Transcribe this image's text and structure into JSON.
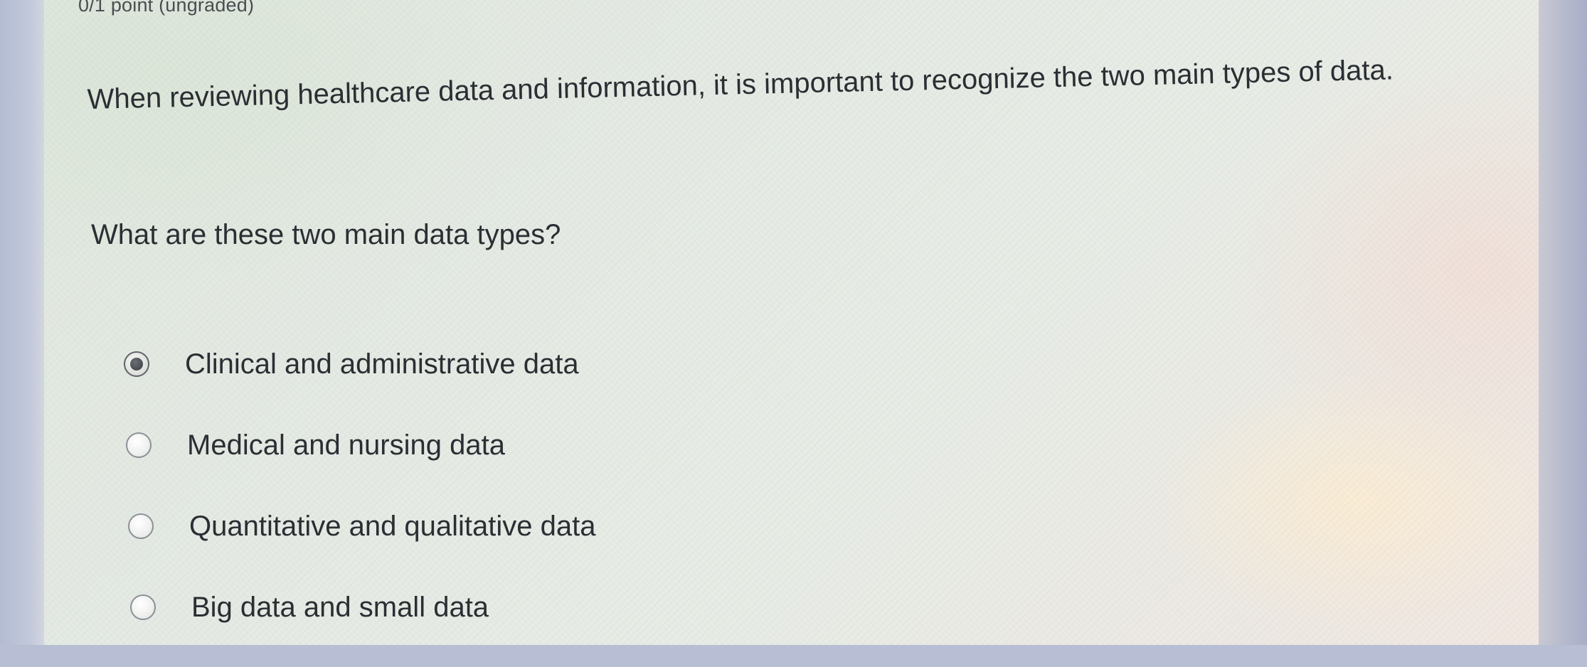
{
  "quiz": {
    "points": "0/1 point (ungraded)",
    "question": "When reviewing healthcare data and information, it is important to recognize the two main types of data.",
    "prompt": "What are these two main data types?",
    "options": [
      {
        "label": "Clinical and administrative data",
        "selected": true
      },
      {
        "label": "Medical and nursing data",
        "selected": false
      },
      {
        "label": "Quantitative and qualitative data",
        "selected": false
      },
      {
        "label": "Big data and small data",
        "selected": false
      }
    ]
  }
}
